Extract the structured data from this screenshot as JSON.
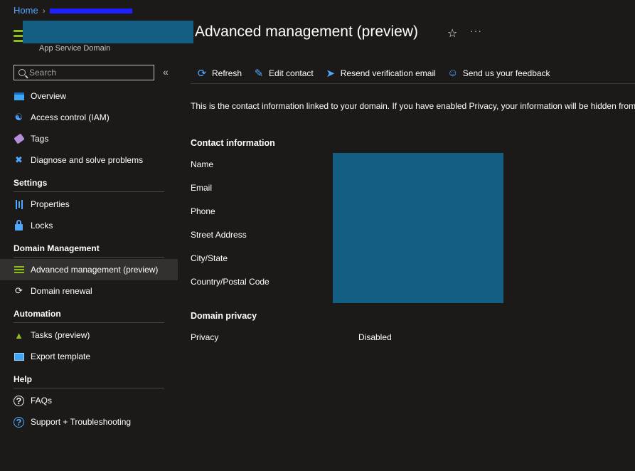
{
  "breadcrumb": {
    "home": "Home"
  },
  "header": {
    "title": "Advanced management (preview)",
    "subtitle": "App Service Domain"
  },
  "search": {
    "placeholder": "Search"
  },
  "sidebar": {
    "top_items": [
      {
        "label": "Overview",
        "icon": "overview-icon"
      },
      {
        "label": "Access control (IAM)",
        "icon": "people-icon"
      },
      {
        "label": "Tags",
        "icon": "tag-icon"
      },
      {
        "label": "Diagnose and solve problems",
        "icon": "wrench-icon"
      }
    ],
    "sections": [
      {
        "title": "Settings",
        "items": [
          {
            "label": "Properties"
          },
          {
            "label": "Locks"
          }
        ]
      },
      {
        "title": "Domain Management",
        "items": [
          {
            "label": "Advanced management (preview)"
          },
          {
            "label": "Domain renewal"
          }
        ]
      },
      {
        "title": "Automation",
        "items": [
          {
            "label": "Tasks (preview)"
          },
          {
            "label": "Export template"
          }
        ]
      },
      {
        "title": "Help",
        "items": [
          {
            "label": "FAQs"
          },
          {
            "label": "Support + Troubleshooting"
          }
        ]
      }
    ]
  },
  "toolbar": {
    "refresh": "Refresh",
    "edit_contact": "Edit contact",
    "resend": "Resend verification email",
    "feedback": "Send us your feedback"
  },
  "main": {
    "intro": "This is the contact information linked to your domain. If you have enabled Privacy, your information will be hidden from",
    "contact_title": "Contact information",
    "fields": [
      "Name",
      "Email",
      "Phone",
      "Street Address",
      "City/State",
      "Country/Postal Code"
    ],
    "privacy_title": "Domain privacy",
    "privacy_label": "Privacy",
    "privacy_value": "Disabled"
  },
  "colors": {
    "background": "#1b1a19",
    "accent": "#4fa8ff",
    "active_nav": "#323130",
    "redaction": "#155e83"
  }
}
